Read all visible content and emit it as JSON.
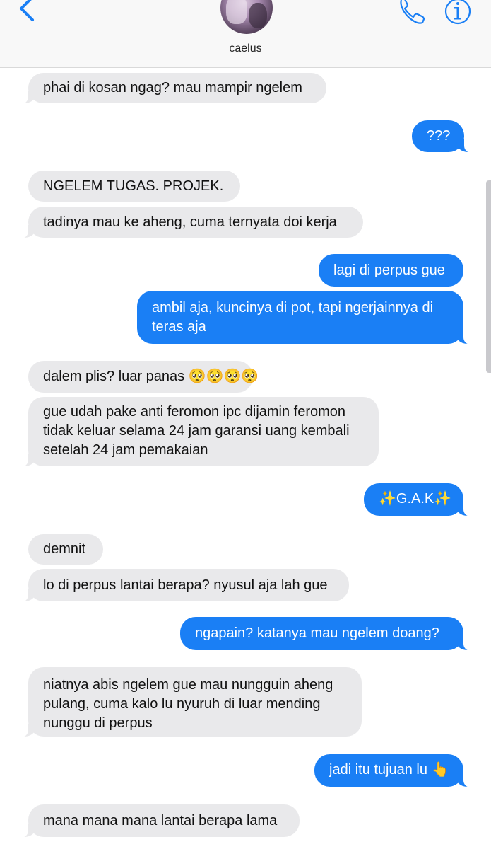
{
  "header": {
    "contact_name": "caelus"
  },
  "messages": [
    {
      "dir": "in",
      "text": "phai di kosan ngag? mau mampir ngelem"
    },
    {
      "dir": "out",
      "text": "???"
    },
    {
      "dir": "in",
      "text": "NGELEM TUGAS. PROJEK."
    },
    {
      "dir": "in",
      "text": "tadinya mau ke aheng, cuma ternyata doi kerja"
    },
    {
      "dir": "out",
      "text": "lagi di perpus gue"
    },
    {
      "dir": "out",
      "text": "ambil aja, kuncinya di pot, tapi ngerjainnya di\nteras aja"
    },
    {
      "dir": "in",
      "text": "dalem plis? luar panas 🥺🥺🥺🥺"
    },
    {
      "dir": "in",
      "text": "gue udah pake anti feromon ipc dijamin feromon\ntidak keluar selama 24 jam garansi uang kembali\nsetelah 24 jam pemakaian"
    },
    {
      "dir": "out",
      "text": "✨G.A.K✨"
    },
    {
      "dir": "in",
      "text": "demnit"
    },
    {
      "dir": "in",
      "text": "lo di perpus lantai berapa? nyusul aja lah gue"
    },
    {
      "dir": "out",
      "text": "ngapain? katanya mau ngelem doang?"
    },
    {
      "dir": "in",
      "text": "niatnya abis ngelem gue mau nungguin aheng\npulang, cuma kalo lu nyuruh di luar mending\nnunggu di perpus"
    },
    {
      "dir": "out",
      "text": "jadi itu tujuan lu 👆"
    },
    {
      "dir": "in",
      "text": "mana mana mana lantai berapa lama"
    }
  ],
  "colors": {
    "accent": "#1a7ff5",
    "incoming_bubble": "#e9e9eb",
    "header_bg": "#f8f8f8"
  },
  "icons": [
    "back-chevron-icon",
    "phone-icon",
    "info-icon"
  ]
}
